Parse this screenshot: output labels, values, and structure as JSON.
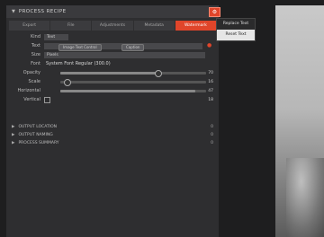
{
  "section": {
    "title": "PROCESS RECIPE"
  },
  "tabs": [
    "Export",
    "File",
    "Adjustments",
    "Metadata",
    "Watermark"
  ],
  "watermark": {
    "kind_label": "Kind",
    "kind_value": "Text",
    "text_label": "Text",
    "text_chip1": "Image Text Control",
    "text_chip2": "Caption",
    "size_label": "Size",
    "size_value": "Pixels",
    "font_label": "Font",
    "font_value": "System Font Regular (300.0)",
    "opacity_label": "Opacity",
    "opacity_value": "70",
    "scale_label": "Scale",
    "scale_value": "16",
    "horizontal_label": "Horizontal",
    "horizontal_value": "47",
    "vertical_label": "Vertical",
    "vertical_value": "18"
  },
  "collapsed_sections": [
    {
      "title": "OUTPUT LOCATION",
      "right": "0"
    },
    {
      "title": "OUTPUT NAMING",
      "right": "0"
    },
    {
      "title": "PROCESS SUMMARY",
      "right": "0"
    }
  ],
  "menu": {
    "item1": "Replace Text",
    "item2": "Reset Text"
  },
  "icons": {
    "gear": "gear-icon"
  },
  "colors": {
    "accent": "#e0452a"
  }
}
